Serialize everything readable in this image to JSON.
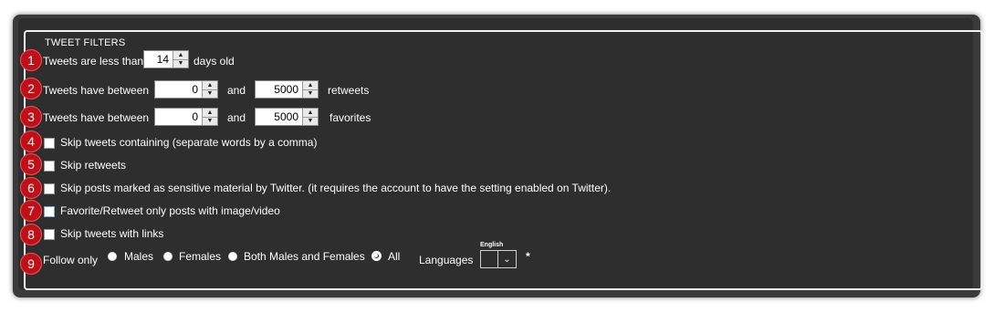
{
  "panel": {
    "title": "TWEET FILTERS"
  },
  "badges": [
    "1",
    "2",
    "3",
    "4",
    "5",
    "6",
    "7",
    "8",
    "9"
  ],
  "row1": {
    "label": "Tweets are less than",
    "days_value": "14",
    "suffix": "days old"
  },
  "row2": {
    "label": "Tweets have between",
    "min_value": "0",
    "and": "and",
    "max_value": "5000",
    "suffix": "retweets"
  },
  "row3": {
    "label": "Tweets have between",
    "min_value": "0",
    "and": "and",
    "max_value": "5000",
    "suffix": "favorites"
  },
  "row4": {
    "label": "Skip tweets containing (separate words by a comma)",
    "checked": false
  },
  "row5": {
    "label": "Skip retweets",
    "checked": false
  },
  "row6": {
    "label": "Skip posts marked as sensitive material by Twitter. (it requires the account to have the setting enabled on Twitter).",
    "checked": false
  },
  "row7": {
    "label": "Favorite/Retweet only posts with image/video",
    "checked": false
  },
  "row8": {
    "label": "Skip tweets with links",
    "checked": false
  },
  "row9": {
    "label": "Follow only",
    "options": [
      "Males",
      "Females",
      "Both Males and Females",
      "All"
    ],
    "selected": "All",
    "languages_label": "Languages",
    "language_caption": "English",
    "language_selected": "",
    "asterisk": "*"
  },
  "icons": {
    "spin_up": "chevron-up-icon",
    "spin_down": "chevron-down-icon",
    "dropdown": "chevron-down-icon"
  }
}
